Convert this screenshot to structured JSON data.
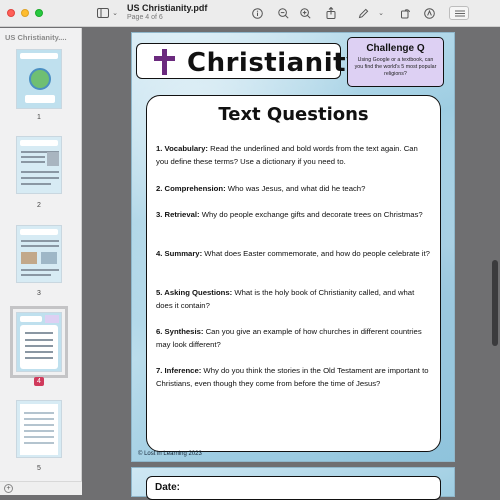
{
  "window": {
    "title": "US Christianity.pdf",
    "subtitle": "Page 4 of 6"
  },
  "sidebar": {
    "title": "US Christianity....",
    "pages": [
      "1",
      "2",
      "3",
      "4",
      "5"
    ],
    "selected_page": "4"
  },
  "page": {
    "title": "Christianity",
    "challenge": {
      "title": "Challenge Q",
      "text": "Using Google or a textbook, can you find the world's 5 most popular religions?"
    },
    "card_title": "Text Questions",
    "questions": [
      {
        "label": "1. Vocabulary:",
        "text": " Read the underlined and bold words from the text again. Can you define these terms? Use a dictionary if you need to."
      },
      {
        "label": "2. Comprehension:",
        "text": " Who was Jesus, and what did he teach?"
      },
      {
        "label": "3. Retrieval:",
        "text": " Why do people exchange gifts and decorate trees on Christmas?"
      },
      {
        "label": "4. Summary:",
        "text": " What does Easter commemorate, and how do people celebrate it?"
      },
      {
        "label": "5. Asking Questions:",
        "text": " What is the holy book of Christianity called, and what does it contain?"
      },
      {
        "label": "6. Synthesis:",
        "text": " Can you give an example of how churches in different countries may look different?"
      },
      {
        "label": "7. Inference:",
        "text": " Why do you think the stories in the Old Testament are important to Christians, even though they come from before the time of Jesus?"
      }
    ],
    "copyright": "© Lost in Learning 2023",
    "next_page_label": "Date:"
  },
  "icons": {
    "sidebar_toggle": "sidebar-icon",
    "info": "info-icon",
    "zoom_out": "zoom-out-icon",
    "zoom_in": "zoom-in-icon",
    "share": "share-icon",
    "markup": "pen-icon",
    "rotate": "rotate-icon",
    "annotate": "markup-icon",
    "search": "search-icon"
  }
}
